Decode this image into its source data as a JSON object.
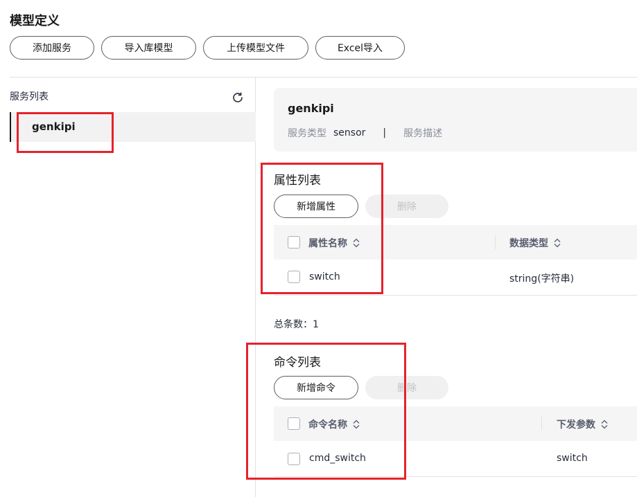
{
  "page": {
    "title": "模型定义"
  },
  "toolbar": {
    "add_service": "添加服务",
    "import_library_model": "导入库模型",
    "upload_model_file": "上传模型文件",
    "excel_import": "Excel导入"
  },
  "sidebar": {
    "header": "服务列表",
    "refresh_icon": "refresh-icon",
    "items": [
      {
        "label": "genkipi",
        "selected": true
      }
    ]
  },
  "service_info": {
    "name": "genkipi",
    "type_label": "服务类型",
    "type_value": "sensor",
    "separator": "|",
    "desc_label": "服务描述"
  },
  "properties": {
    "title": "属性列表",
    "add_button": "新增属性",
    "delete_button": "删除",
    "columns": [
      "属性名称",
      "数据类型"
    ],
    "rows": [
      {
        "name": "switch",
        "type": "string(字符串)"
      }
    ],
    "total": "总条数：1"
  },
  "commands": {
    "title": "命令列表",
    "add_button": "新增命令",
    "delete_button": "删除",
    "columns": [
      "命令名称",
      "下发参数"
    ],
    "rows": [
      {
        "name": "cmd_switch",
        "param": "switch"
      }
    ]
  },
  "colors": {
    "highlight": "#e5222b",
    "text": "#252b3a",
    "muted": "#8a8e99"
  }
}
